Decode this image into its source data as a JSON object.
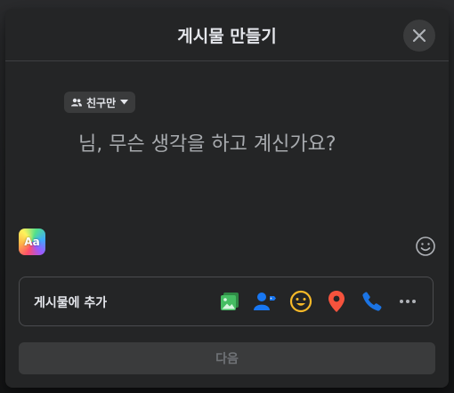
{
  "header": {
    "title": "게시물 만들기"
  },
  "audience": {
    "label": "친구만"
  },
  "composer": {
    "placeholder": "님, 무슨 생각을 하고 계신가요?"
  },
  "background_picker": {
    "label": "Aa"
  },
  "add_to_post": {
    "label": "게시물에 추가",
    "icons": [
      "photo-video-icon",
      "tag-people-icon",
      "feeling-icon",
      "check-in-icon",
      "call-icon",
      "more-icon"
    ]
  },
  "footer": {
    "next_label": "다음"
  },
  "colors": {
    "modal_bg": "#242526",
    "photo_green": "#45bd62",
    "tag_blue": "#1877f2",
    "feeling_yellow": "#f7b928",
    "checkin_red": "#f5533d",
    "call_blue": "#1b74e4"
  }
}
